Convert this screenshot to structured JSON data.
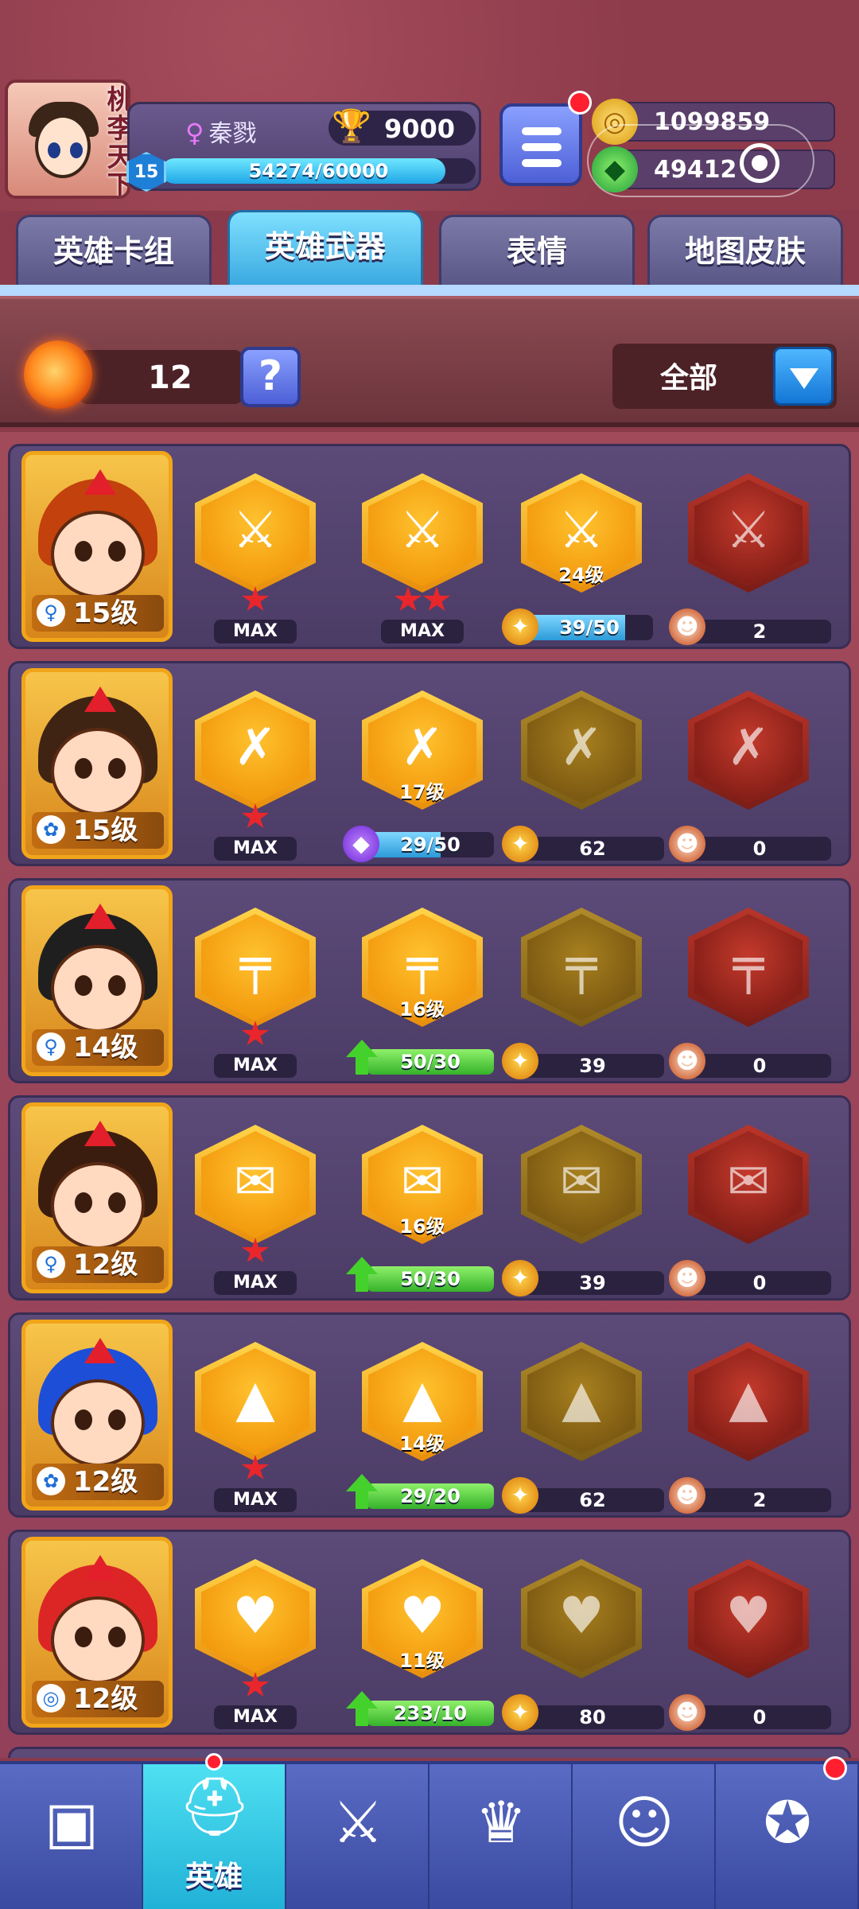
{
  "player": {
    "name": "秦戮",
    "tag_text": "桃李天下",
    "trophies": "9000",
    "level": "15",
    "xp_text": "54274/60000",
    "xp_fraction": 0.9046
  },
  "currency": {
    "gold": "1099859",
    "gems": "49412"
  },
  "tabs": [
    "英雄卡组",
    "英雄武器",
    "表情",
    "地图皮肤"
  ],
  "active_tab": 1,
  "filter": {
    "token_count": "12",
    "help_label": "?",
    "select_label": "全部"
  },
  "heroes": [
    {
      "level": "15级",
      "class_icon": "♀",
      "hair": "#c2410c",
      "weapon": "⚔",
      "w1": {
        "label": "MAX",
        "stars": 1
      },
      "w2": {
        "label": "MAX",
        "stars": 2
      },
      "w3": {
        "level": "24级",
        "progress": "39/50",
        "fraction": 0.78,
        "bar": "blue"
      },
      "w4": {
        "count": "2"
      }
    },
    {
      "level": "15级",
      "class_icon": "✿",
      "hair": "#3f2414",
      "weapon": "✗",
      "w1": {
        "label": "MAX",
        "stars": 1
      },
      "w2": {
        "level": "17级",
        "progress": "29/50",
        "fraction": 0.58,
        "bar": "blue"
      },
      "w3": {
        "count": "62"
      },
      "w4": {
        "count": "0"
      }
    },
    {
      "level": "14级",
      "class_icon": "♀",
      "hair": "#1f1f1f",
      "weapon": "╤",
      "w1": {
        "label": "MAX",
        "stars": 1
      },
      "w2": {
        "level": "16级",
        "progress": "50/30",
        "fraction": 1.0,
        "bar": "green"
      },
      "w3": {
        "count": "39"
      },
      "w4": {
        "count": "0"
      }
    },
    {
      "level": "12级",
      "class_icon": "♀",
      "hair": "#3b1d0f",
      "weapon": "✉",
      "w1": {
        "label": "MAX",
        "stars": 1
      },
      "w2": {
        "level": "16级",
        "progress": "50/30",
        "fraction": 1.0,
        "bar": "green"
      },
      "w3": {
        "count": "39"
      },
      "w4": {
        "count": "0"
      }
    },
    {
      "level": "12级",
      "class_icon": "✿",
      "hair": "#1d4ed8",
      "weapon": "▲",
      "w1": {
        "label": "MAX",
        "stars": 1
      },
      "w2": {
        "level": "14级",
        "progress": "29/20",
        "fraction": 1.0,
        "bar": "green"
      },
      "w3": {
        "count": "62"
      },
      "w4": {
        "count": "2"
      }
    },
    {
      "level": "12级",
      "class_icon": "◎",
      "hair": "#dc2626",
      "weapon": "♥",
      "w1": {
        "label": "MAX",
        "stars": 1
      },
      "w2": {
        "level": "11级",
        "progress": "233/10",
        "fraction": 1.0,
        "bar": "green"
      },
      "w3": {
        "count": "80"
      },
      "w4": {
        "count": "0"
      }
    }
  ],
  "nav": [
    {
      "name": "treasure-chest",
      "icon": "▣",
      "label": ""
    },
    {
      "name": "hero",
      "icon": "⛑",
      "label": "英雄"
    },
    {
      "name": "battle",
      "icon": "⚔",
      "label": ""
    },
    {
      "name": "rank",
      "icon": "♛",
      "label": ""
    },
    {
      "name": "friends",
      "icon": "☺",
      "label": ""
    },
    {
      "name": "explore",
      "icon": "✪",
      "label": ""
    }
  ],
  "nav_active": 1,
  "colors": {
    "accent": "#3aa9e0",
    "gold": "#f39b0f",
    "bg": "#8a3a4a"
  }
}
